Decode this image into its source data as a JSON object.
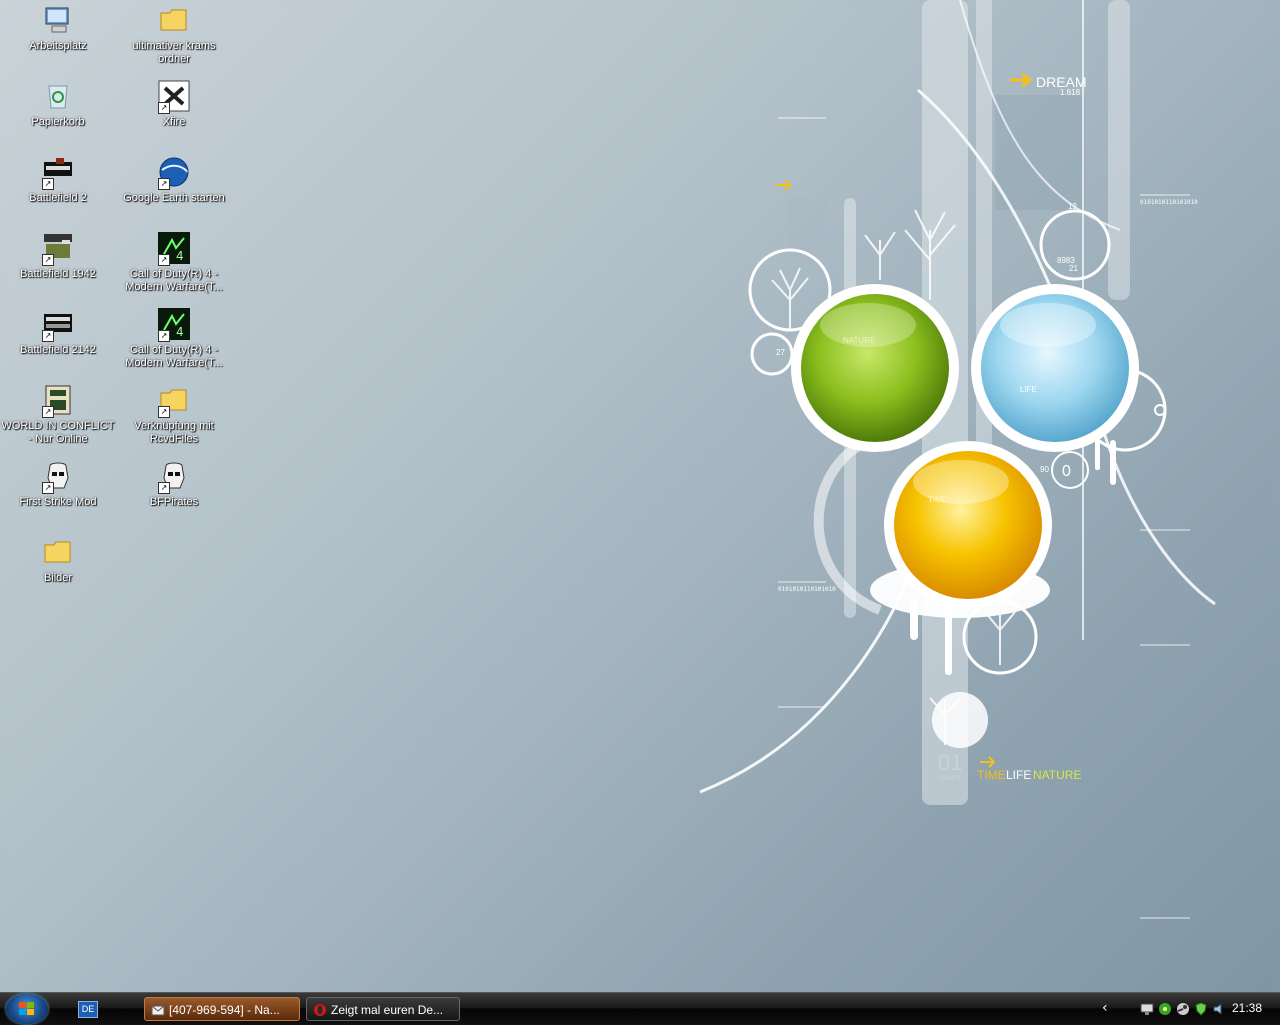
{
  "wallpaper": {
    "texts": {
      "dream": "DREAM",
      "dream_num": "1.618",
      "nature": "NATURE",
      "life": "LIFE",
      "time": "TIME",
      "num_12": "12",
      "num_8983": "8983",
      "num_21": "21",
      "num_27": "27",
      "num_90": "90",
      "num_0": "0",
      "num_01": "01",
      "nature_small": "nature",
      "binary": "0101010110101010",
      "bottom_time": "TIME",
      "bottom_life": "LIFE",
      "bottom_nature": "NATURE"
    }
  },
  "desktop_icons": [
    {
      "label": "Arbeitsplatz",
      "icon": "computer-icon",
      "shortcut": false
    },
    {
      "label": "ultimativer krams ordner",
      "icon": "folder-icon",
      "shortcut": false
    },
    {
      "label": "Papierkorb",
      "icon": "recycle-bin-icon",
      "shortcut": false
    },
    {
      "label": "Xfire",
      "icon": "xfire-icon",
      "shortcut": true
    },
    {
      "label": "Battlefield 2",
      "icon": "battlefield2-icon",
      "shortcut": true
    },
    {
      "label": "Google Earth starten",
      "icon": "google-earth-icon",
      "shortcut": true
    },
    {
      "label": "Battlefield 1942",
      "icon": "battlefield1942-icon",
      "shortcut": true
    },
    {
      "label": "Call of Duty(R) 4 - Modern Warfare(T...",
      "icon": "cod4-icon",
      "shortcut": true
    },
    {
      "label": "Battlefield 2142",
      "icon": "battlefield2142-icon",
      "shortcut": true
    },
    {
      "label": "Call of Duty(R) 4 - Modern Warfare(T...",
      "icon": "cod4-icon",
      "shortcut": true
    },
    {
      "label": "WORLD IN CONFLICT - Nur Online",
      "icon": "world-in-conflict-icon",
      "shortcut": true
    },
    {
      "label": "Verknüpfung mit RcvdFiles",
      "icon": "folder-icon",
      "shortcut": true
    },
    {
      "label": "First Strike Mod",
      "icon": "stormtrooper-icon",
      "shortcut": true
    },
    {
      "label": "BFPirates",
      "icon": "stormtrooper-icon",
      "shortcut": true
    },
    {
      "label": "Bilder",
      "icon": "folder-icon",
      "shortcut": false
    }
  ],
  "taskbar": {
    "language": "DE",
    "tasks": [
      {
        "label": "[407-969-594] - Na...",
        "icon": "mail-icon",
        "active": true
      },
      {
        "label": "Zeigt mal euren De...",
        "icon": "opera-icon",
        "active": false
      }
    ],
    "tray_icons": [
      "network-icon",
      "green-flower-icon",
      "steam-icon",
      "shield-icon",
      "speaker-icon"
    ],
    "clock": "21:38"
  },
  "colors": {
    "green_orb": "#8cbf1e",
    "blue_orb": "#8fd3ee",
    "yellow_orb": "#f5b800",
    "accent_yellow": "#f4c01a"
  }
}
